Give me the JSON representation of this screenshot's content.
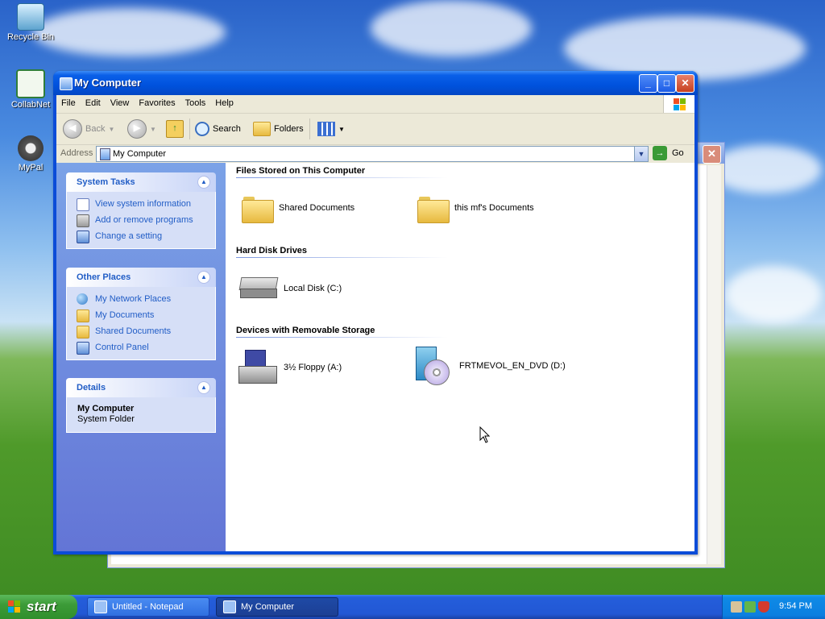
{
  "desktop": {
    "icons": [
      {
        "label": "Recycle Bin"
      },
      {
        "label": "CollabNet"
      },
      {
        "label": "MyPal"
      }
    ]
  },
  "window": {
    "title": "My Computer",
    "caption": {
      "minimize": "_",
      "maximize": "□",
      "close": "✕"
    }
  },
  "menu": [
    "File",
    "Edit",
    "View",
    "Favorites",
    "Tools",
    "Help"
  ],
  "toolbar": {
    "back": "Back",
    "search": "Search",
    "folders": "Folders"
  },
  "address": {
    "label": "Address",
    "value": "My Computer",
    "go": "Go"
  },
  "tasks": {
    "system": {
      "title": "System Tasks",
      "items": [
        "View system information",
        "Add or remove programs",
        "Change a setting"
      ]
    },
    "other": {
      "title": "Other Places",
      "items": [
        "My Network Places",
        "My Documents",
        "Shared Documents",
        "Control Panel"
      ]
    },
    "details": {
      "title": "Details",
      "name": "My Computer",
      "type": "System Folder"
    }
  },
  "groups": {
    "files": {
      "title": "Files Stored on This Computer",
      "items": [
        "Shared Documents",
        "this mf's Documents"
      ]
    },
    "hdd": {
      "title": "Hard Disk Drives",
      "items": [
        "Local Disk (C:)"
      ]
    },
    "removable": {
      "title": "Devices with Removable Storage",
      "items": [
        "3½ Floppy (A:)",
        "FRTMEVOL_EN_DVD (D:)"
      ]
    }
  },
  "taskbar": {
    "start": "start",
    "buttons": [
      "Untitled - Notepad",
      "My Computer"
    ],
    "clock": "9:54 PM"
  },
  "colors": {
    "xp_blue": "#0052dd",
    "link": "#215dc6",
    "start_green": "#3c9b38"
  }
}
